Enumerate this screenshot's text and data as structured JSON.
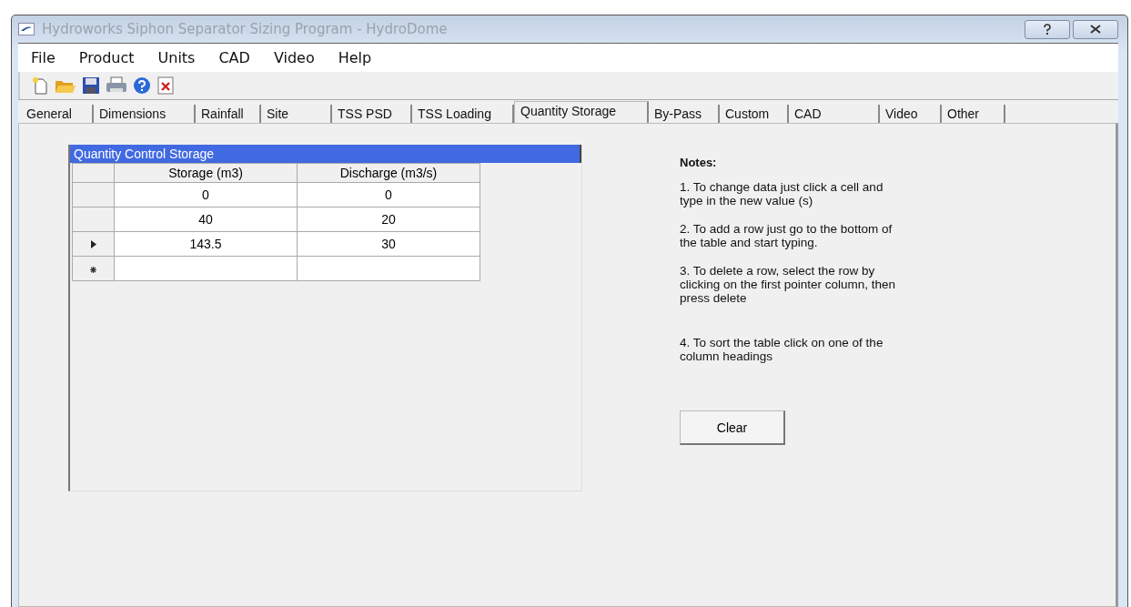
{
  "window": {
    "title": "Hydroworks Siphon Separator Sizing Program - HydroDome"
  },
  "menu": [
    "File",
    "Product",
    "Units",
    "CAD",
    "Video",
    "Help"
  ],
  "tabs": [
    {
      "label": "General",
      "selected": false
    },
    {
      "label": "Dimensions",
      "selected": false
    },
    {
      "label": "Rainfall",
      "selected": false
    },
    {
      "label": "Site",
      "selected": false
    },
    {
      "label": "TSS PSD",
      "selected": false
    },
    {
      "label": "TSS Loading",
      "selected": false
    },
    {
      "label": "Quantity Storage",
      "selected": true
    },
    {
      "label": "By-Pass",
      "selected": false
    },
    {
      "label": "Custom",
      "selected": false
    },
    {
      "label": "CAD",
      "selected": false
    },
    {
      "label": "Video",
      "selected": false
    },
    {
      "label": "Other",
      "selected": false
    }
  ],
  "table": {
    "title": "Quantity Control Storage",
    "columns": [
      "Storage (m3)",
      "Discharge (m3/s)"
    ],
    "rows": [
      {
        "kind": "plain",
        "cells": [
          "0",
          "0"
        ]
      },
      {
        "kind": "plain",
        "cells": [
          "40",
          "20"
        ]
      },
      {
        "kind": "current",
        "cells": [
          "143.5",
          "30"
        ]
      },
      {
        "kind": "new",
        "cells": []
      }
    ]
  },
  "notes": {
    "heading": "Notes:",
    "items": [
      "1. To change data just click a cell and type in the new value (s)",
      "2. To add a row just go to the bottom of the table and start typing.",
      "3. To delete a row, select the row by clicking on the first pointer column, then press delete",
      "4. To sort the table click on one of the column headings"
    ]
  },
  "buttons": [
    "Clear"
  ]
}
